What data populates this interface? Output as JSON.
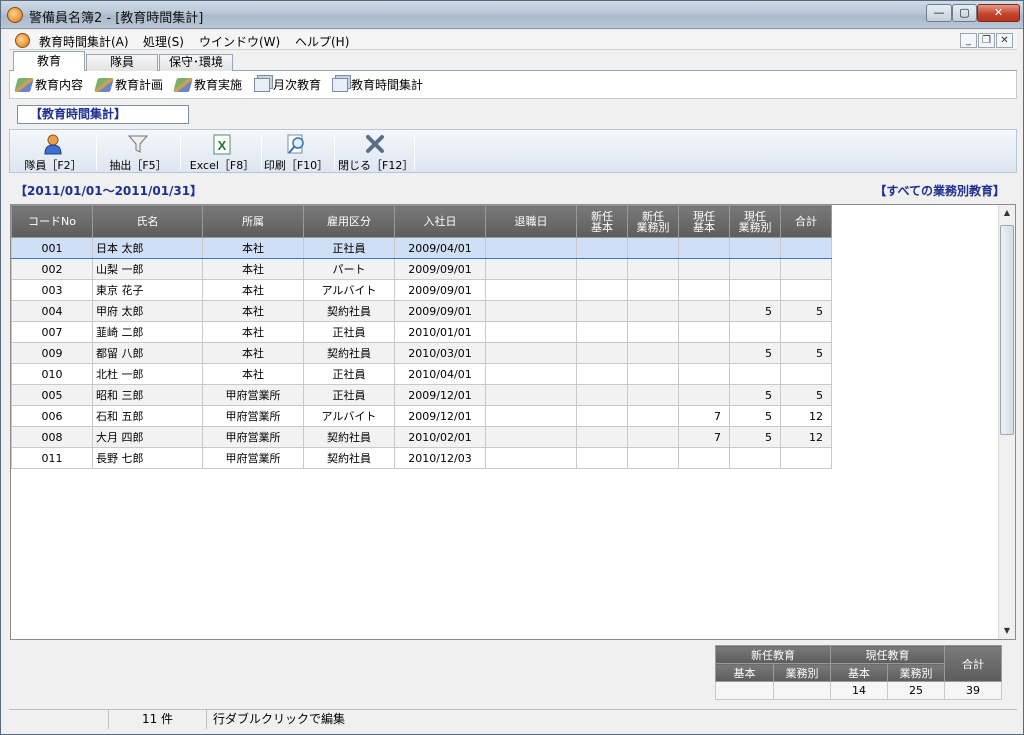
{
  "window": {
    "title": "警備員名簿2 - [教育時間集計]"
  },
  "menu": [
    "教育時間集計(A)",
    "処理(S)",
    "ウインドウ(W)",
    "ヘルプ(H)"
  ],
  "tabs": [
    "教育",
    "隊員",
    "保守･環境"
  ],
  "subtoolbar": [
    "教育内容",
    "教育計画",
    "教育実施",
    "月次教育",
    "教育時間集計"
  ],
  "page_title": "【教育時間集計】",
  "toolbar": {
    "members": "隊員［F2］",
    "extract": "抽出［F5］",
    "excel": "Excel［F8］",
    "print": "印刷［F10］",
    "close": "閉じる［F12］"
  },
  "range": "【2011/01/01～2011/01/31】",
  "category": "【すべての業務別教育】",
  "grid": {
    "headers": [
      "コードNo",
      "氏名",
      "所属",
      "雇用区分",
      "入社日",
      "退職日",
      "新任\n基本",
      "新任\n業務別",
      "現任\n基本",
      "現任\n業務別",
      "合計"
    ],
    "rows": [
      [
        "001",
        "日本 太郎",
        "本社",
        "正社員",
        "2009/04/01",
        "",
        "",
        "",
        "",
        "",
        ""
      ],
      [
        "002",
        "山梨 一郎",
        "本社",
        "パート",
        "2009/09/01",
        "",
        "",
        "",
        "",
        "",
        ""
      ],
      [
        "003",
        "東京 花子",
        "本社",
        "アルバイト",
        "2009/09/01",
        "",
        "",
        "",
        "",
        "",
        ""
      ],
      [
        "004",
        "甲府 太郎",
        "本社",
        "契約社員",
        "2009/09/01",
        "",
        "",
        "",
        "",
        "5",
        "5"
      ],
      [
        "007",
        "韮崎 二郎",
        "本社",
        "正社員",
        "2010/01/01",
        "",
        "",
        "",
        "",
        "",
        ""
      ],
      [
        "009",
        "都留 八郎",
        "本社",
        "契約社員",
        "2010/03/01",
        "",
        "",
        "",
        "",
        "5",
        "5"
      ],
      [
        "010",
        "北杜 一郎",
        "本社",
        "正社員",
        "2010/04/01",
        "",
        "",
        "",
        "",
        "",
        ""
      ],
      [
        "005",
        "昭和 三郎",
        "甲府営業所",
        "正社員",
        "2009/12/01",
        "",
        "",
        "",
        "",
        "5",
        "5"
      ],
      [
        "006",
        "石和 五郎",
        "甲府営業所",
        "アルバイト",
        "2009/12/01",
        "",
        "",
        "",
        "7",
        "5",
        "12"
      ],
      [
        "008",
        "大月 四郎",
        "甲府営業所",
        "契約社員",
        "2010/02/01",
        "",
        "",
        "",
        "7",
        "5",
        "12"
      ],
      [
        "011",
        "長野 七郎",
        "甲府営業所",
        "契約社員",
        "2010/12/03",
        "",
        "",
        "",
        "",
        "",
        ""
      ]
    ]
  },
  "summary": {
    "group_new": "新任教育",
    "group_current": "現任教育",
    "total_label": "合計",
    "sub_basic": "基本",
    "sub_business": "業務別",
    "new_basic": "",
    "new_business": "",
    "current_basic": "14",
    "current_business": "25",
    "total": "39"
  },
  "status": {
    "count": "11 件",
    "hint": "行ダブルクリックで編集"
  }
}
